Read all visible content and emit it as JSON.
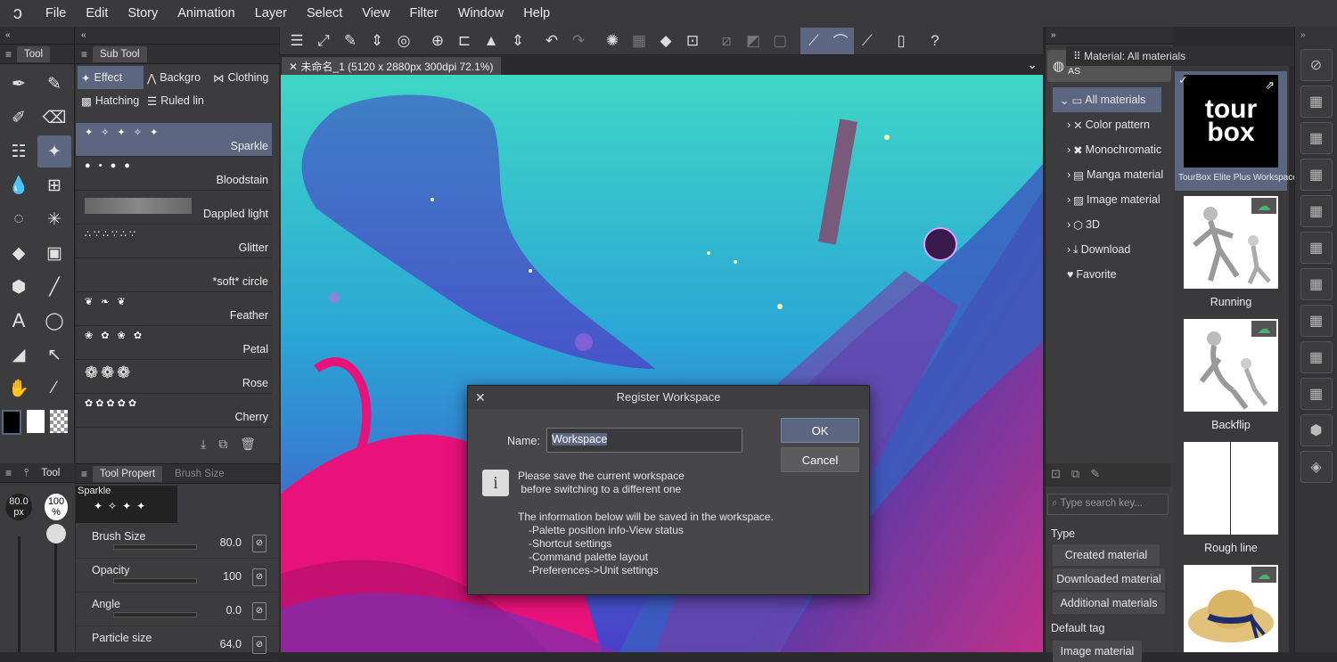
{
  "menu": [
    "File",
    "Edit",
    "Story",
    "Animation",
    "Layer",
    "Select",
    "View",
    "Filter",
    "Window",
    "Help"
  ],
  "tool_panel": {
    "title": "Tool"
  },
  "sub_tool_panel": {
    "title": "Sub Tool",
    "tabs": [
      "Effect",
      "Backgro",
      "Clothing",
      "Hatching",
      "Ruled lin"
    ],
    "brushes": [
      "Sparkle",
      "Bloodstain",
      "Dappled light",
      "Glitter",
      "*soft* circle",
      "Feather",
      "Petal",
      "Rose",
      "Cherry"
    ]
  },
  "tool_property": {
    "tab1": "Tool Propert",
    "tab2": "Brush Size",
    "preview_label": "Sparkle",
    "props": [
      {
        "label": "Brush Size",
        "value": "80.0"
      },
      {
        "label": "Opacity",
        "value": "100"
      },
      {
        "label": "Angle",
        "value": "0.0"
      },
      {
        "label": "Particle size",
        "value": "64.0"
      }
    ]
  },
  "size_panel": {
    "title": "Tool",
    "size_value": "80.0",
    "size_unit": "px",
    "opacity_value": "100",
    "opacity_unit": "%"
  },
  "document": {
    "tab_title": "未命名_1 (5120 x 2880px 300dpi 72.1%)"
  },
  "dialog": {
    "title": "Register Workspace",
    "name_label": "Name:",
    "name_value": "Workspace",
    "ok": "OK",
    "cancel": "Cancel",
    "msg1": "Please save the current workspace",
    "msg2": " before switching to a different one",
    "info": "The information below will be saved in the workspace.",
    "items": [
      "-Palette position info-View status",
      "-Shortcut settings",
      "-Command palette layout",
      "-Preferences->Unit settings"
    ]
  },
  "material": {
    "title": "Material: All materials",
    "search_assets": "Search for materials on AS",
    "tree": [
      "All materials",
      "Color pattern",
      "Monochromatic",
      "Manga material",
      "Image material",
      "3D",
      "Download",
      "Favorite"
    ],
    "search_placeholder": "Type search key...",
    "type_label": "Type",
    "type_buttons": [
      "Created material",
      "Downloaded material",
      "Additional materials"
    ],
    "default_tag": "Default tag",
    "tag_button": "Image material",
    "thumbs": [
      "TourBox Elite Plus Workspace",
      "Running",
      "Backflip",
      "Rough line"
    ],
    "tourbox_logo": "tour box"
  }
}
